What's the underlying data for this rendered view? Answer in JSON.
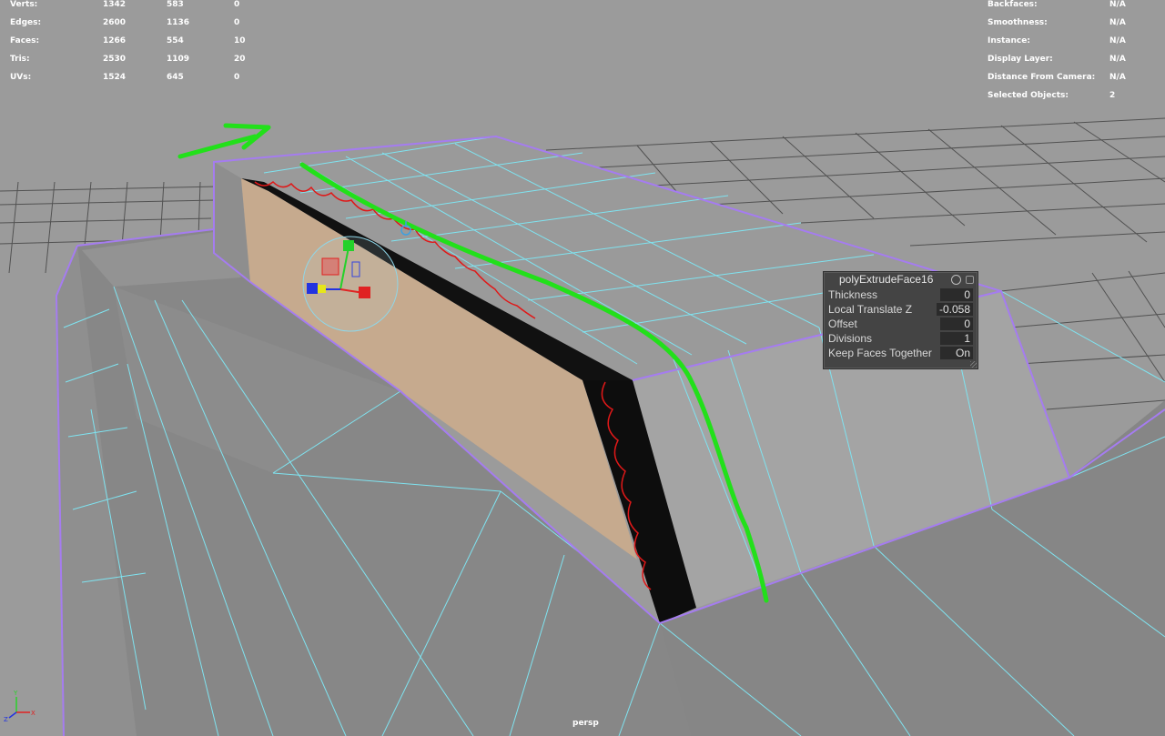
{
  "hud_left": {
    "rows": [
      {
        "label": "Verts:",
        "v1": "1342",
        "v2": "583",
        "v3": "0"
      },
      {
        "label": "Edges:",
        "v1": "2600",
        "v2": "1136",
        "v3": "0"
      },
      {
        "label": "Faces:",
        "v1": "1266",
        "v2": "554",
        "v3": "10"
      },
      {
        "label": "Tris:",
        "v1": "2530",
        "v2": "1109",
        "v3": "20"
      },
      {
        "label": "UVs:",
        "v1": "1524",
        "v2": "645",
        "v3": "0"
      }
    ]
  },
  "hud_right": {
    "rows": [
      {
        "label": "Backfaces:",
        "value": "N/A"
      },
      {
        "label": "Smoothness:",
        "value": "N/A"
      },
      {
        "label": "Instance:",
        "value": "N/A"
      },
      {
        "label": "Display Layer:",
        "value": "N/A"
      },
      {
        "label": "Distance From Camera:",
        "value": "N/A"
      },
      {
        "label": "Selected Objects:",
        "value": "2"
      }
    ]
  },
  "panel": {
    "title": "polyExtrudeFace16",
    "fields": [
      {
        "label": "Thickness",
        "value": "0"
      },
      {
        "label": "Local Translate Z",
        "value": "-0.058"
      },
      {
        "label": "Offset",
        "value": "0"
      },
      {
        "label": "Divisions",
        "value": "1"
      },
      {
        "label": "Keep Faces Together",
        "value": "On"
      }
    ]
  },
  "camera_label": "persp",
  "colors": {
    "viewport_bg": "#9b9b9b",
    "mesh_face": "#8a8a8a",
    "wire_cyan": "#7fe3f0",
    "wire_purple": "#a57cf0",
    "annotation_green": "#22e01a",
    "annotation_red": "#e01818",
    "extruded_face": "#c7aa8c"
  },
  "icons": [
    "move-manipulator-icon",
    "pivot-icon",
    "axis-indicator-icon",
    "panel-settings-icon",
    "panel-close-icon"
  ]
}
